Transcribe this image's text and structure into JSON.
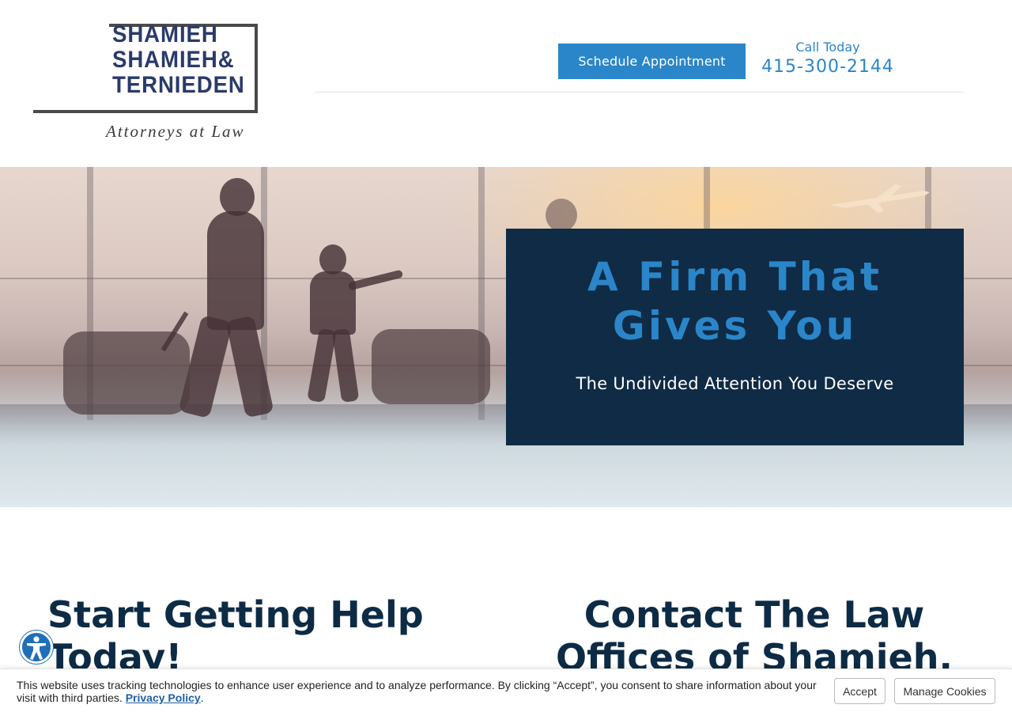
{
  "header": {
    "logo": {
      "lines": [
        "SHAMIEH",
        "SHAMIEH&",
        "TERNIEDEN"
      ],
      "tagline": "Attorneys at Law"
    },
    "schedule_label": "Schedule Appointment",
    "call_label": "Call Today",
    "phone": "415-300-2144"
  },
  "hero": {
    "title": "A Firm That Gives You",
    "subtitle": "The Undivided Attention You Deserve"
  },
  "section": {
    "left_heading": "Start Getting Help Today!",
    "right_heading": "Contact The Law Offices of Shamieh,"
  },
  "cookie_banner": {
    "text": "This website uses tracking technologies to enhance user experience and to analyze performance. By clicking “Accept”, you consent to share information about your visit with third parties.",
    "link_label": "Privacy Policy",
    "trailing": ".",
    "accept_label": "Accept",
    "manage_label": "Manage Cookies"
  },
  "colors": {
    "accent": "#2a86c9",
    "navy": "#0f2b45",
    "logo_text": "#2a3a6a"
  },
  "icons": {
    "accessibility": "accessibility-icon"
  }
}
